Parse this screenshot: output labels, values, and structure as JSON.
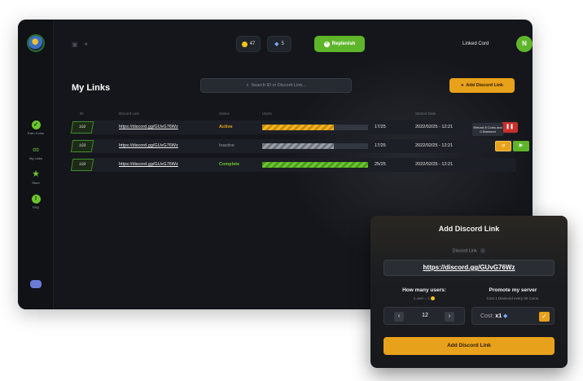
{
  "topbar": {
    "coins": "47",
    "diamonds": "5",
    "replenish_label": "Replenish",
    "linked_label": "Linked Cord",
    "avatar_initial": "N"
  },
  "sidebar": {
    "items": [
      {
        "label": "Earn Coins",
        "icon": "earn-coins-icon"
      },
      {
        "label": "My Links",
        "icon": "link-icon"
      },
      {
        "label": "Store",
        "icon": "star-icon"
      },
      {
        "label": "FAQ",
        "icon": "help-icon"
      }
    ],
    "discord_icon": "discord-icon"
  },
  "page": {
    "title": "My Links",
    "search_placeholder": "Search ID or Discord Link...",
    "add_button": "Add Discord Link"
  },
  "table": {
    "headers": [
      "ID",
      "Discord Link",
      "Status",
      "Users",
      "Started Date"
    ],
    "rows": [
      {
        "id": "102",
        "link": "https://discord.gg/GUvG76Wz",
        "status": "Active",
        "count": "17/25",
        "progress": 0.68,
        "date": "2022/02/25 - 12:21"
      },
      {
        "id": "103",
        "link": "https://discord.gg/GUvG76Wz",
        "status": "Inactive",
        "count": "17/25",
        "progress": 0.68,
        "date": "2022/02/25 - 12:21"
      },
      {
        "id": "103",
        "link": "https://discord.gg/GUvG76Wz",
        "status": "Complete",
        "count": "25/25",
        "progress": 1.0,
        "date": "2022/02/25 - 12:21"
      }
    ],
    "tooltip": "Refund 8 Coins and 0 Diamond"
  },
  "modal": {
    "title": "Add Discord Link",
    "link_label": "Discord Link",
    "link_value": "https://discord.gg/GUvG76Wz",
    "users_heading": "How many users:",
    "users_sub": "1 user = 1",
    "users_value": "12",
    "promote_heading": "Promote my server",
    "promote_sub": "Cost 1 Diamond every 50 Coins.",
    "cost_label": "Cost:",
    "cost_value": "x1",
    "submit_label": "Add Discord Link"
  },
  "colors": {
    "accent_green": "#5fb52a",
    "accent_orange": "#e8a11a",
    "danger_red": "#c9302c",
    "background": "#14161b"
  }
}
